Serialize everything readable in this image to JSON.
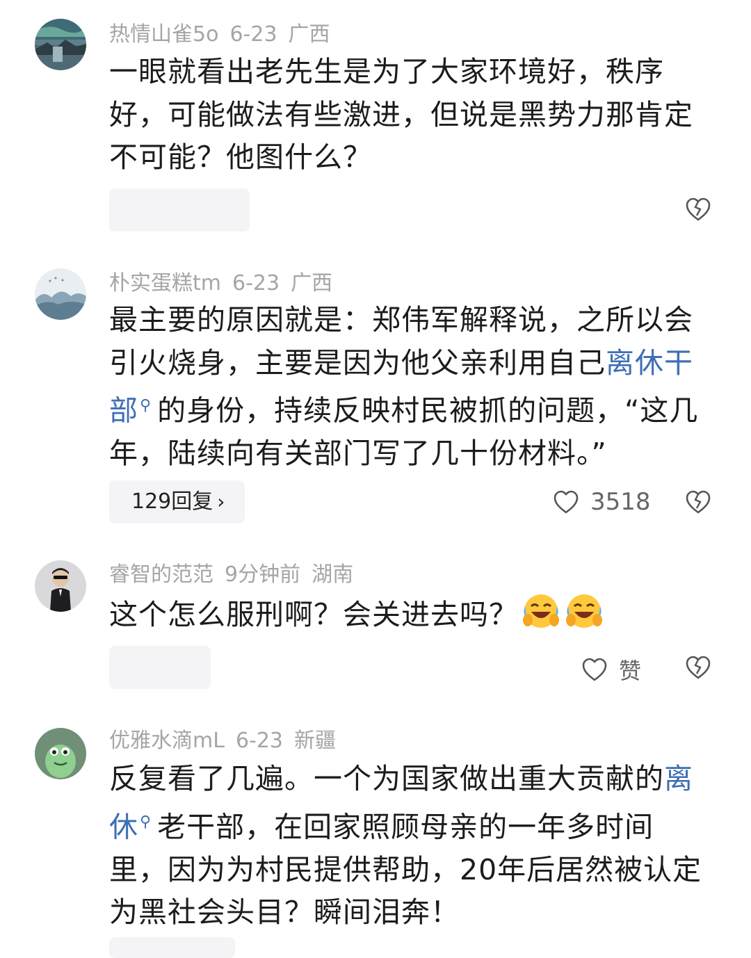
{
  "comments": [
    {
      "username": "热情山雀5o",
      "time": "6-23",
      "location": "广西",
      "text_parts": [
        "一眼就看出老先生是为了大家环境好，秩序好，可能做法有些激进，但说是黑势力那肯定不可能？他图什么？"
      ],
      "reply_label": "",
      "like_count": "",
      "like_label": ""
    },
    {
      "username": "朴实蛋糕tm",
      "time": "6-23",
      "location": "广西",
      "text_parts": [
        "最主要的原因就是：郑伟军解释说，之所以会引火烧身，主要是因为他父亲利用自己",
        "离休干部",
        "的身份，持续反映村民被抓的问题，“这几年，陆续向有关部门写了几十份材料。”"
      ],
      "reply_label": "129回复",
      "like_count": "3518",
      "like_label": ""
    },
    {
      "username": "睿智的范范",
      "time": "9分钟前",
      "location": "湖南",
      "text_parts": [
        "这个怎么服刑啊？会关进去吗？"
      ],
      "reply_label": "",
      "like_count": "",
      "like_label": "赞"
    },
    {
      "username": "优雅水滴mL",
      "time": "6-23",
      "location": "新疆",
      "text_parts": [
        "反复看了几遍。一个为国家做出重大贡献的",
        "离休",
        "老干部，在回家照顾母亲的一年多时间里，因为为村民提供帮助，20年后居然被认定为黑社会头目？瞬间泪奔！"
      ],
      "reply_label": "",
      "like_count": "",
      "like_label": ""
    }
  ],
  "colors": {
    "meta_text": "#a5a5a8",
    "body_text": "#1c1c1e",
    "link": "#3f6fb5",
    "pill_bg": "#f4f4f6"
  },
  "icons": {
    "like": "heart-outline-icon",
    "dislike": "broken-heart-icon",
    "link_search": "search-icon",
    "reply_more": "chevron-right-icon",
    "emoji": "laughing-crying-emoji-icon"
  }
}
